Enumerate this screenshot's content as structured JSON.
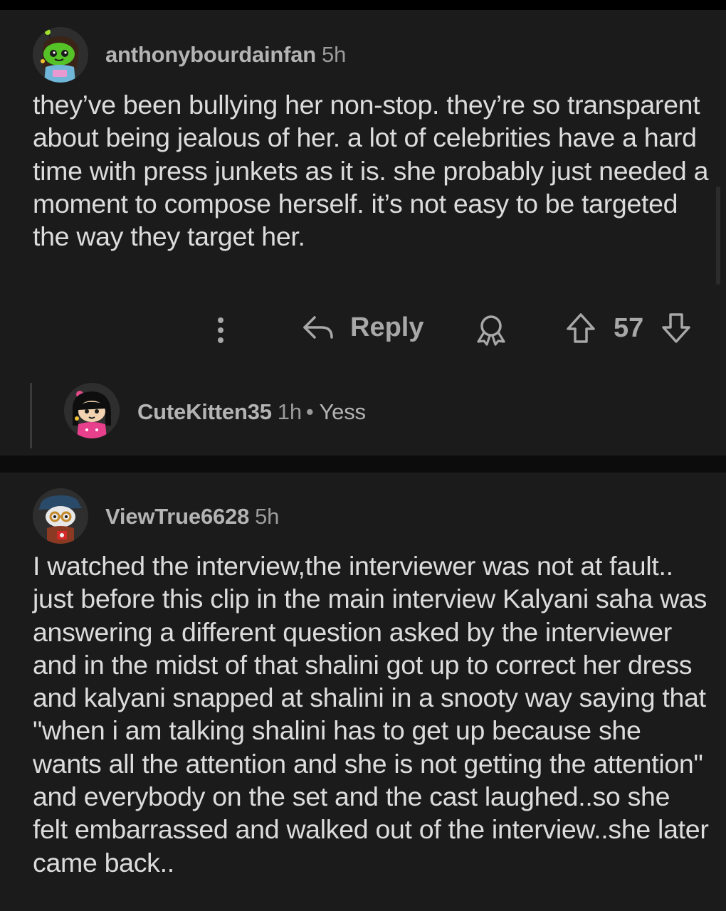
{
  "comments": [
    {
      "username": "anthonybourdainfan",
      "time": "5h",
      "body": "they’ve been bullying her non-stop. they’re so transparent about being jealous of her. a lot of celebrities have a hard time with press junkets as it is. she probably just needed a moment to compose herself. it’s not easy to be targeted the way they target her.",
      "actions": {
        "reply_label": "Reply",
        "vote_count": "57"
      },
      "reply": {
        "username": "CuteKitten35",
        "time": "1h",
        "separator": "•",
        "preview": "Yess"
      }
    },
    {
      "username": "ViewTrue6628",
      "time": "5h",
      "body": "I watched the interview,the interviewer was not at fault.. just before this clip in the main interview Kalyani saha was answering a different question asked by the interviewer and in the midst of that shalini got up to correct her dress and kalyani snapped at shalini in a snooty way saying that \"when i am talking shalini has to get up because she wants all the attention and she is not getting the attention\" and everybody on the set and the cast laughed..so she felt embarrassed and walked out of the interview..she later came back.."
    }
  ],
  "icons": {
    "more": "more-vertical-icon",
    "reply": "reply-arrow-icon",
    "award": "award-icon",
    "upvote": "upvote-arrow-icon",
    "downvote": "downvote-arrow-icon"
  },
  "colors": {
    "background": "#1b1b1b",
    "text": "#dcdcdc",
    "muted": "#9b9b9b",
    "separator": "#0c0c0c"
  }
}
